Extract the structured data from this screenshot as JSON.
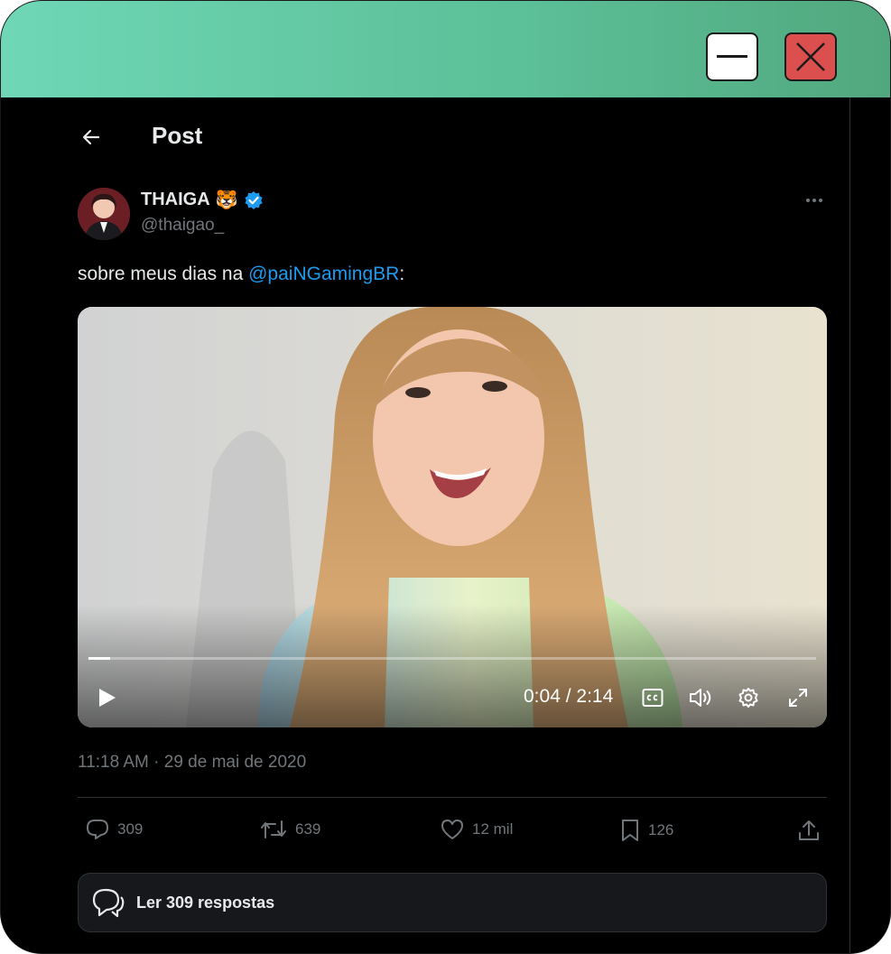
{
  "window": {
    "minimize_icon": "minus-icon",
    "close_icon": "x-icon",
    "colors": {
      "titlebar": "#5bbf97",
      "close": "#db4f4f"
    }
  },
  "header": {
    "title": "Post",
    "back_icon": "arrow-left-icon"
  },
  "author": {
    "name": "THAIGA",
    "emoji": "🐯",
    "verified_icon": "verified-badge-icon",
    "handle": "@thaigao_"
  },
  "tweet": {
    "text_prefix": "sobre meus dias na ",
    "mention": "@paiNGamingBR",
    "text_suffix": ":",
    "timestamp": "11:18 AM · 29 de mai de 2020"
  },
  "video": {
    "current_time": "0:04",
    "separator": " / ",
    "duration": "2:14",
    "progress": 0.03,
    "controls": [
      "play-icon",
      "captions-icon",
      "volume-icon",
      "settings-icon",
      "fullscreen-icon"
    ]
  },
  "actions": {
    "replies": "309",
    "reposts": "639",
    "likes": "12 mil",
    "bookmarks": "126"
  },
  "read_replies": {
    "label": "Ler 309 respostas"
  },
  "colors": {
    "accent": "#1d9bf0",
    "text": "#e7e9ea",
    "muted": "#71767b"
  }
}
